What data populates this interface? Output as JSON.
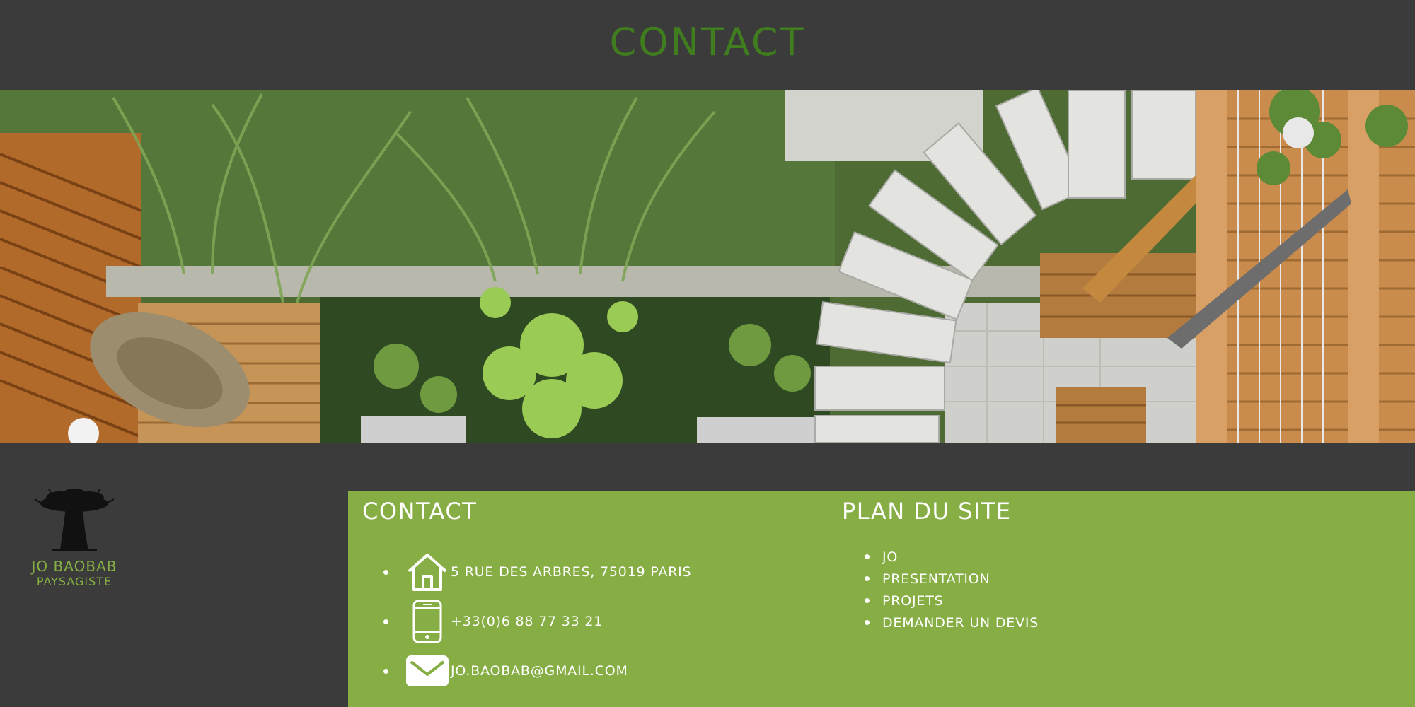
{
  "header": {
    "title": "CONTACT"
  },
  "hero": {
    "image_alt": ""
  },
  "logo": {
    "name": "JO BAOBAB",
    "tagline": "PAYSAGISTE",
    "icon": "baobab-tree-icon"
  },
  "footer": {
    "contact": {
      "title": "CONTACT",
      "items": [
        {
          "icon": "house-icon",
          "text": "5 RUE DES ARBRES, 75019 PARIS"
        },
        {
          "icon": "phone-icon",
          "text": "+33(0)6 88 77 33 21"
        },
        {
          "icon": "mail-icon",
          "text": "JO.BAOBAB@GMAIL.COM"
        }
      ]
    },
    "sitemap": {
      "title": "PLAN DU SITE",
      "items": [
        "JO",
        "PRESENTATION",
        "PROJETS",
        "DEMANDER UN DEVIS"
      ]
    }
  },
  "colors": {
    "dark": "#3b3b3b",
    "accent_green": "#87ad45",
    "title_green": "#3f7d1f"
  }
}
